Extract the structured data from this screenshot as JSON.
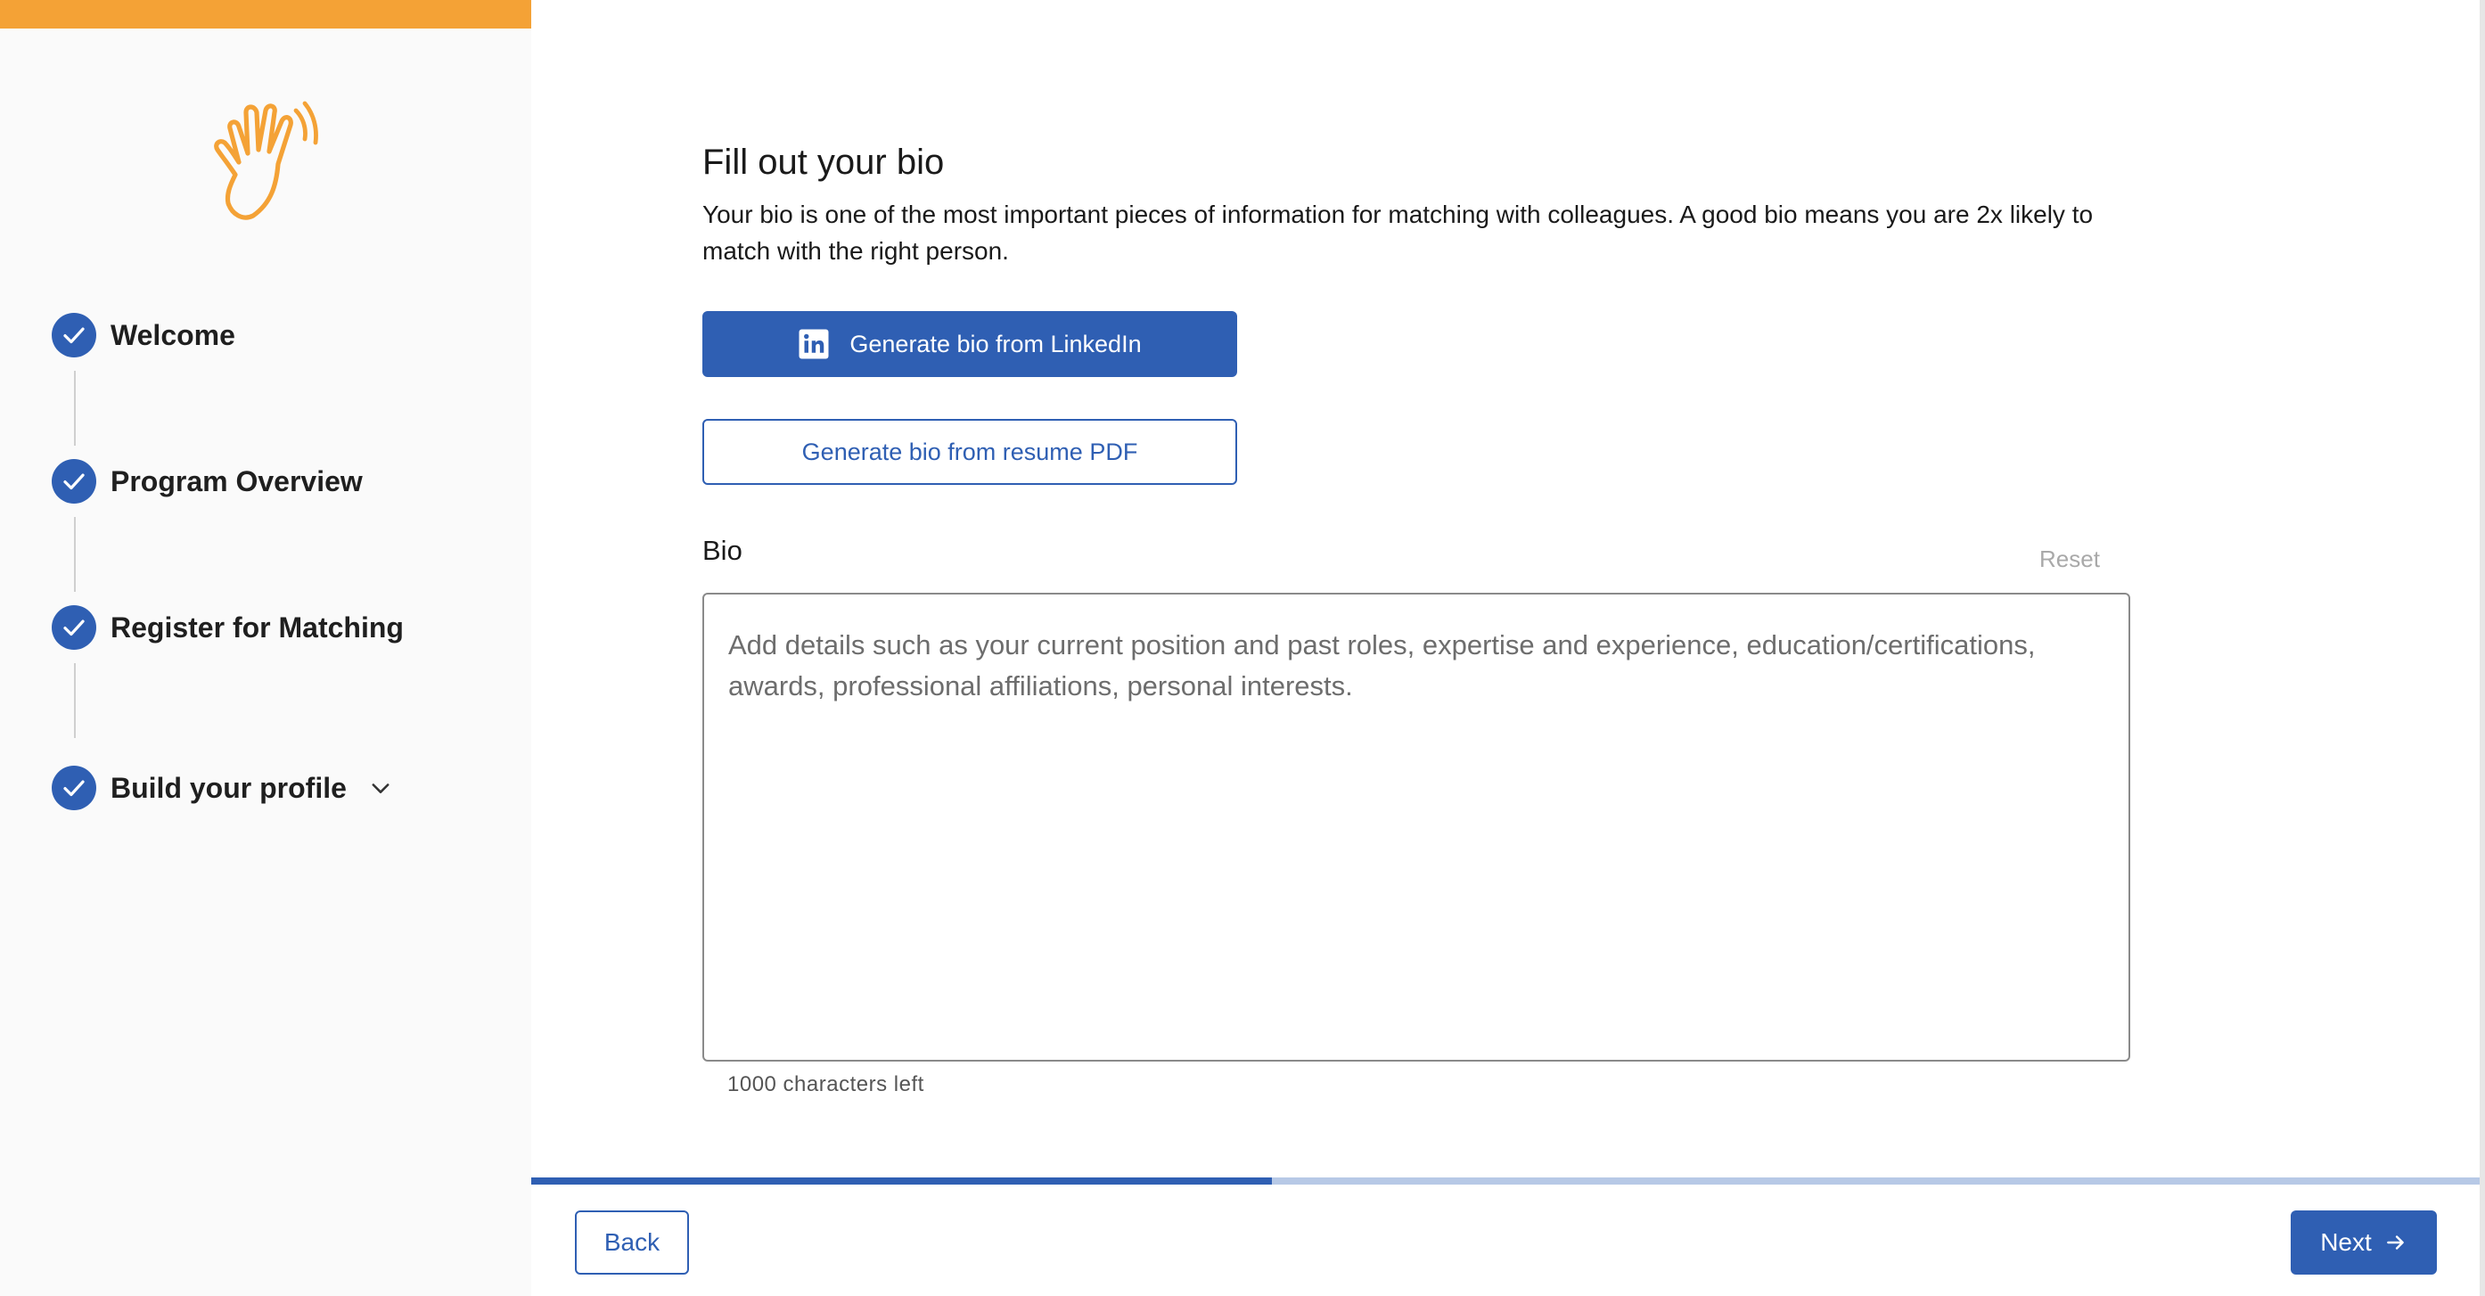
{
  "sidebar": {
    "brand_color": "#f4a236",
    "logo_icon": "waving-hand-icon",
    "steps": [
      {
        "label": "Welcome",
        "status": "complete"
      },
      {
        "label": "Program Overview",
        "status": "complete"
      },
      {
        "label": "Register for Matching",
        "status": "complete"
      },
      {
        "label": "Build your profile",
        "status": "complete",
        "expandable": true
      }
    ]
  },
  "main": {
    "title": "Fill out your bio",
    "description": "Your bio is one of the most important pieces of information for matching with colleagues. A good bio means you are 2x likely to match with the right person.",
    "linkedin_button": "Generate bio from LinkedIn",
    "resume_button": "Generate bio from resume PDF",
    "bio": {
      "label": "Bio",
      "reset": "Reset",
      "value": "",
      "placeholder": "Add details such as your current position and past roles, expertise and experience, education/certifications, awards, professional affiliations, personal interests.",
      "chars_left": "1000 characters left"
    }
  },
  "footer": {
    "progress_fraction": 0.38,
    "back": "Back",
    "next": "Next"
  },
  "colors": {
    "primary": "#2f5fb3",
    "progress_track": "#b7c9e6",
    "accent": "#f4a236"
  }
}
